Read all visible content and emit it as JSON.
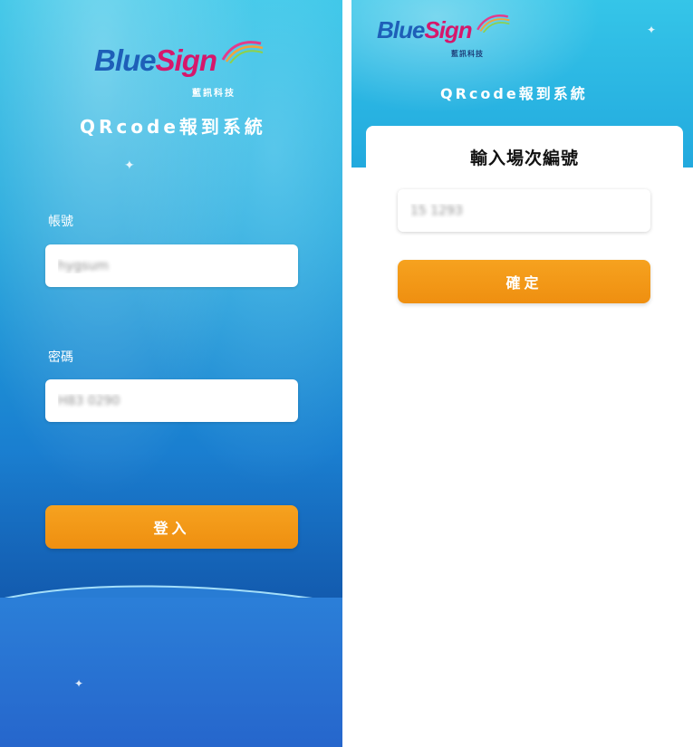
{
  "brand": {
    "logo_part1": "Blue",
    "logo_part2": "Sign",
    "subtitle": "藍訊科技",
    "accent_blue": "#1e5fb8",
    "accent_pink": "#d6176b"
  },
  "app_title": "QRcode報到系統",
  "login": {
    "account_label": "帳號",
    "account_value": "hygsum",
    "password_label": "密碼",
    "password_value": "H83 0290",
    "login_button": "登入"
  },
  "session": {
    "card_title": "輸入場次編號",
    "session_value": "15 1293",
    "confirm_button": "確定"
  },
  "colors": {
    "button_orange": "#ef8f10",
    "background_blue": "#22a7dc"
  }
}
